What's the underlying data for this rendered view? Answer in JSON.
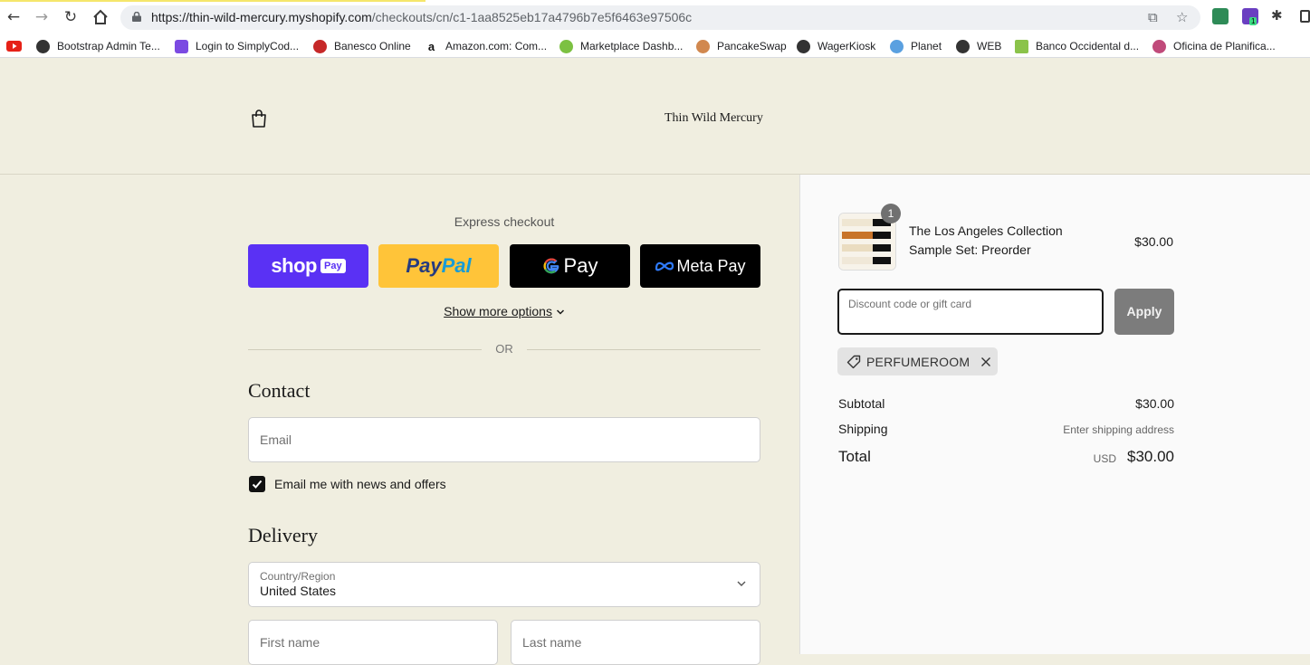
{
  "browser": {
    "url_host": "https://thin-wild-mercury.myshopify.com",
    "url_path": "/checkouts/cn/c1-1aa8525eb17a4796b7e5f6463e97506c",
    "extension_badge": "1"
  },
  "bookmarks": [
    {
      "label": "Bootstrap Admin Te...",
      "color": "#333333"
    },
    {
      "label": "Login to SimplyCod...",
      "color": "#7b4ae2"
    },
    {
      "label": "Banesco Online",
      "color": "#c62828"
    },
    {
      "label": "Amazon.com: Com...",
      "color": "#111111"
    },
    {
      "label": "Marketplace Dashb...",
      "color": "#7cc142"
    },
    {
      "label": "PancakeSwap",
      "color": "#d1884f"
    },
    {
      "label": "WagerKiosk",
      "color": "#333333"
    },
    {
      "label": "Planet",
      "color": "#5aa0e0"
    },
    {
      "label": "WEB",
      "color": "#333333"
    },
    {
      "label": "Banco Occidental d...",
      "color": "#8bc34a"
    },
    {
      "label": "Oficina de Planifica...",
      "color": "#c04a7a"
    }
  ],
  "shop": {
    "brand": "Thin Wild Mercury"
  },
  "checkout": {
    "express_title": "Express checkout",
    "shop_pay": {
      "label": "shop",
      "badge": "Pay",
      "color": "#5a31f4"
    },
    "paypal": {
      "label_pay": "Pay",
      "label_pal": "Pal",
      "color": "#ffc439"
    },
    "gpay": {
      "label": "Pay",
      "color": "#000000"
    },
    "metapay": {
      "label": "Meta Pay",
      "color": "#000000"
    },
    "show_more": "Show more options",
    "or": "OR",
    "contact_title": "Contact",
    "email_placeholder": "Email",
    "newsletter_label": "Email me with news and offers",
    "newsletter_checked": true,
    "delivery_title": "Delivery",
    "country_label": "Country/Region",
    "country_value": "United States",
    "first_name_placeholder": "First name",
    "last_name_placeholder": "Last name"
  },
  "summary": {
    "quantity": "1",
    "product_name": "The Los Angeles Collection Sample Set: Preorder",
    "product_price": "$30.00",
    "discount_placeholder": "Discount code or gift card",
    "apply_label": "Apply",
    "applied_code": "PERFUMEROOM",
    "subtotal_label": "Subtotal",
    "subtotal_value": "$30.00",
    "shipping_label": "Shipping",
    "shipping_value": "Enter shipping address",
    "total_label": "Total",
    "currency": "USD",
    "total_value": "$30.00"
  }
}
